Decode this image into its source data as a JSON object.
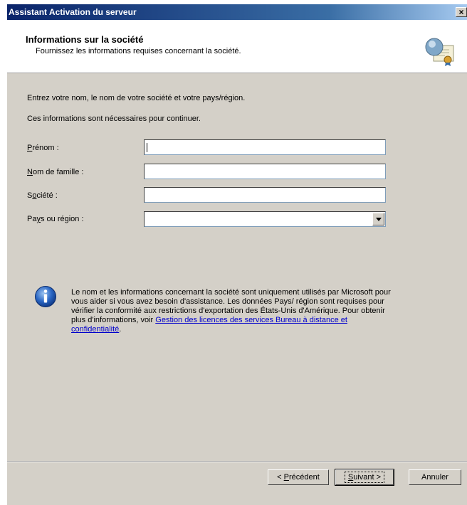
{
  "window": {
    "title": "Assistant Activation du serveur",
    "close_label": "×"
  },
  "header": {
    "title": "Informations sur la société",
    "subtitle": "Fournissez les informations requises concernant la société."
  },
  "intro": {
    "line1": "Entrez votre nom, le nom de votre société et votre pays/région.",
    "line2": "Ces informations sont nécessaires pour continuer."
  },
  "form": {
    "first_name": {
      "mnemonic": "P",
      "label_rest": "rénom :",
      "value": ""
    },
    "last_name": {
      "mnemonic": "N",
      "label_rest": "om de famille :",
      "value": ""
    },
    "company": {
      "label_pre": "S",
      "mnemonic": "o",
      "label_rest": "ciété :",
      "value": ""
    },
    "country": {
      "label_pre": "Pa",
      "mnemonic": "y",
      "label_rest": "s ou région :",
      "value": ""
    }
  },
  "info": {
    "text": "Le nom et les informations concernant la société sont uniquement utilisés par Microsoft pour vous aider si vous avez besoin d'assistance. Les données Pays/ région sont requises pour vérifier la conformité aux restrictions d'exportation des États-Unis d'Amérique. Pour obtenir plus d'informations, voir ",
    "link": "Gestion des licences des services Bureau à distance et confidentialité",
    "end": "."
  },
  "buttons": {
    "back": {
      "pre": "< ",
      "mnemonic": "P",
      "rest": "récédent"
    },
    "next": {
      "mnemonic": "S",
      "rest": "uivant >"
    },
    "cancel": "Annuler"
  },
  "icons": {
    "header": "certificate-icon",
    "info": "info-icon"
  },
  "colors": {
    "titlebar_start": "#0a246a",
    "titlebar_end": "#a6caf0",
    "dialog_bg": "#d4d0c8",
    "link": "#0000cc"
  }
}
